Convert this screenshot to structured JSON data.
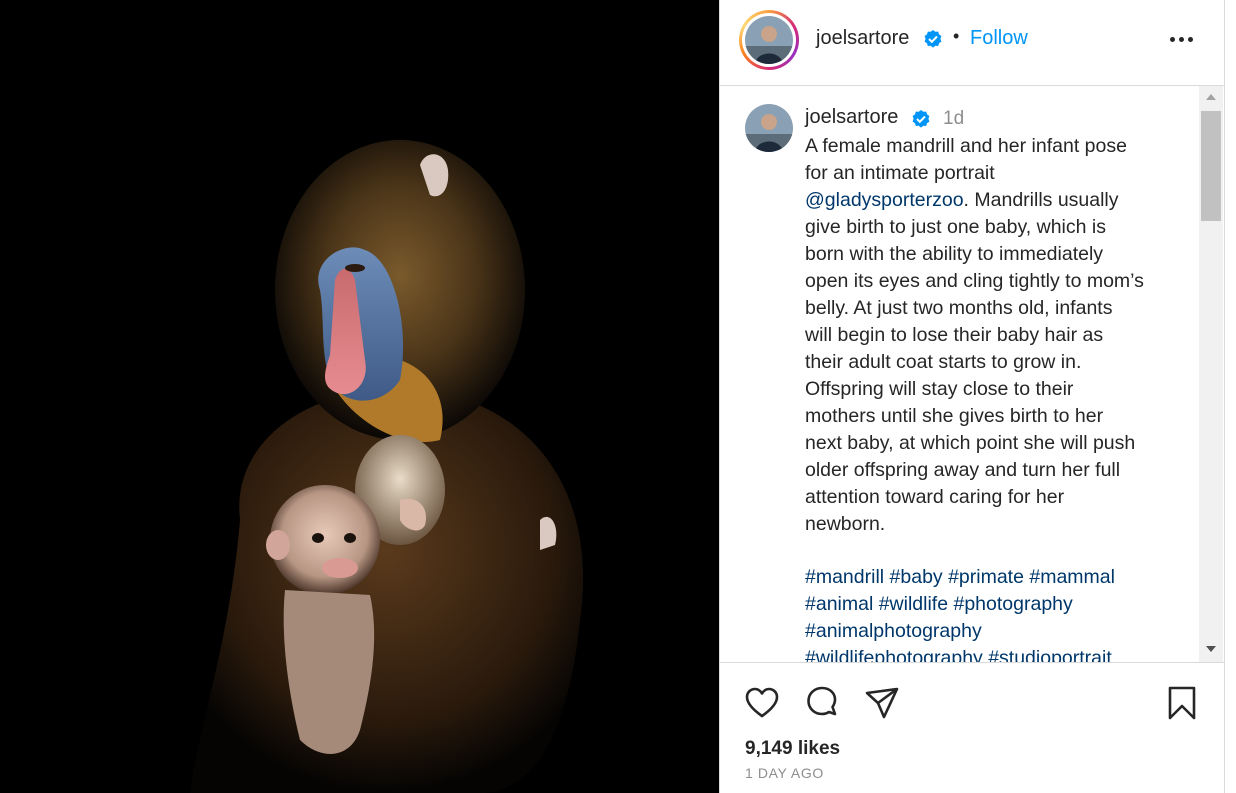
{
  "post": {
    "image_alt": "A female mandrill holding her infant against a black background",
    "author": {
      "username": "joelsartore",
      "verified": true,
      "avatar": "profile-photo"
    },
    "header": {
      "separator": "•",
      "follow_label": "Follow",
      "more_icon": "more-horizontal-icon"
    },
    "caption": {
      "time": "1d",
      "lines": [
        "A female mandrill and her infant pose",
        "for an intimate portrait"
      ],
      "mention": "@gladysporterzoo",
      "after_mention": ". Mandrills usually",
      "body_lines": [
        "give birth to just one baby, which is",
        "born with the ability to immediately",
        "open its eyes and cling tightly to mom’s",
        "belly. At just two months old, infants",
        "will begin to lose their baby hair as",
        "their adult coat starts to grow in.",
        "Offspring will stay close to their",
        "mothers until she gives birth to her",
        "next baby, at which point she will push",
        "older offspring away and turn her full",
        "attention toward caring for her",
        "newborn."
      ],
      "hashtag_lines": [
        "#mandrill #baby #primate #mammal",
        "#animal #wildlife #photography",
        "#animalphotography",
        "#wildlifephotography #studioportrait"
      ]
    },
    "actions": {
      "icons": [
        "heart-icon",
        "comment-icon",
        "share-icon",
        "bookmark-icon"
      ]
    },
    "likes": "9,149 likes",
    "date": "1 DAY AGO"
  },
  "colors": {
    "follow": "#0095f6",
    "link": "#00376b",
    "verified": "#0095f6",
    "muted": "#8e8e8e"
  }
}
